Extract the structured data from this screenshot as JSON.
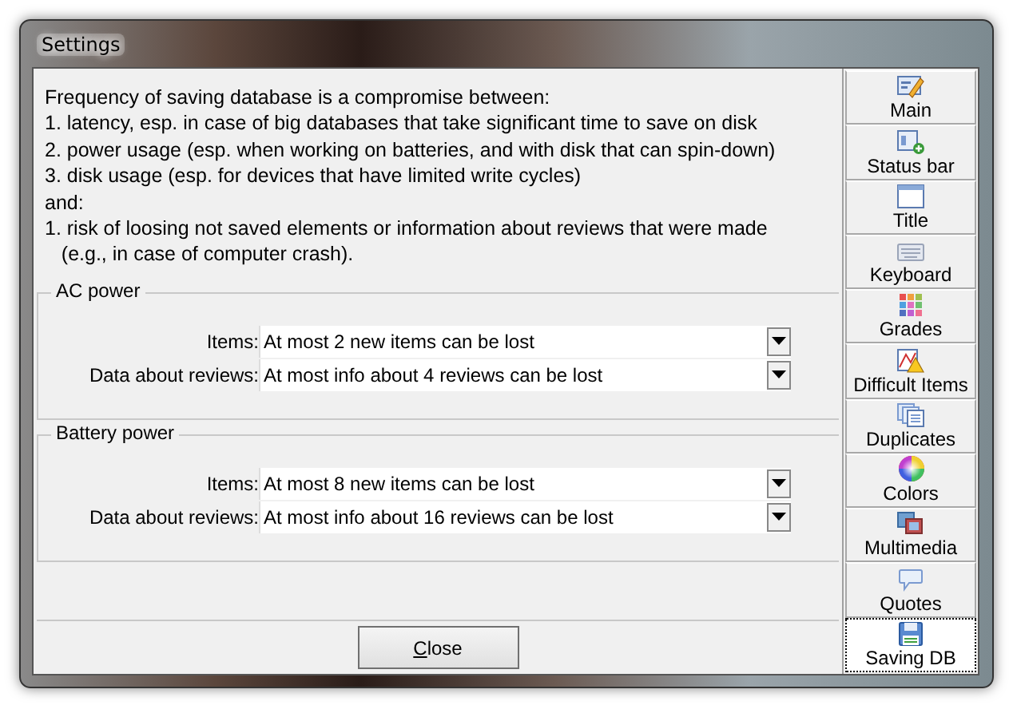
{
  "window": {
    "title": "Settings"
  },
  "description": [
    "Frequency of saving database is a compromise between:",
    "1. latency, esp. in case of big databases that take significant time to save on disk",
    "2. power usage (esp. when working on batteries, and with disk that can spin-down)",
    "3. disk usage (esp. for devices that have limited write cycles)",
    "and:",
    "1. risk of loosing not saved elements or information about reviews that were made",
    "   (e.g., in case of computer crash)."
  ],
  "groups": [
    {
      "title": "AC power",
      "fields": [
        {
          "label": "Items:",
          "value": "At most 2 new items can be lost"
        },
        {
          "label": "Data about reviews:",
          "value": "At most info about 4 reviews can be lost"
        }
      ]
    },
    {
      "title": "Battery power",
      "fields": [
        {
          "label": "Items:",
          "value": "At most 8 new items can be lost"
        },
        {
          "label": "Data about reviews:",
          "value": "At most info about 16 reviews can be lost"
        }
      ]
    }
  ],
  "close_button": {
    "label": "Close",
    "mnemonic_underlined": true
  },
  "sidebar": {
    "items": [
      {
        "label": "Main",
        "selected": false
      },
      {
        "label": "Status bar",
        "selected": false
      },
      {
        "label": "Title",
        "selected": false
      },
      {
        "label": "Keyboard",
        "selected": false
      },
      {
        "label": "Grades",
        "selected": false
      },
      {
        "label": "Difficult Items",
        "selected": false
      },
      {
        "label": "Duplicates",
        "selected": false
      },
      {
        "label": "Colors",
        "selected": false
      },
      {
        "label": "Multimedia",
        "selected": false
      },
      {
        "label": "Quotes",
        "selected": false
      },
      {
        "label": "Saving DB",
        "selected": true
      }
    ]
  }
}
